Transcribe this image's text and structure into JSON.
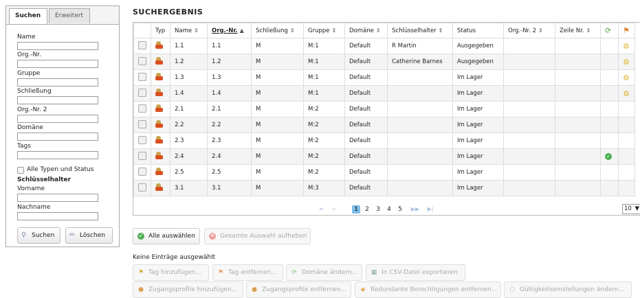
{
  "panel": {
    "tabs": [
      "Suchen",
      "Erweitert"
    ],
    "fields": [
      "Name",
      "Org.-Nr.",
      "Gruppe",
      "Schließung",
      "Org.-Nr. 2",
      "Domäne",
      "Tags"
    ],
    "all_types_label": "Alle Typen und Status",
    "keyholder_heading": "Schlüsselhalter",
    "firstname_label": "Vorname",
    "lastname_label": "Nachname",
    "search_button": "Suchen",
    "clear_button": "Löschen",
    "icons": {
      "search": "magnifier-icon",
      "clear": "eraser-icon"
    }
  },
  "results": {
    "title": "Suchergebnis",
    "columns": [
      "",
      "Typ",
      "Name",
      "Org.-Nr.",
      "Schließung",
      "Gruppe",
      "Domäne",
      "Schlüsselhalter",
      "Status",
      "Org.-Nr. 2",
      "Zeile Nr.",
      "",
      ""
    ],
    "sort_arrows": [
      "",
      "",
      "⇕",
      "▲",
      "⇕",
      "⇕",
      "⇕",
      "⇕",
      "",
      "⇕",
      "⇕",
      "",
      ""
    ],
    "rows": [
      {
        "name": "1.1",
        "org": "1.1",
        "closing": "M",
        "group": "M:1",
        "domain": "Default",
        "holder": "R Martin",
        "status": "Ausgegeben",
        "org2": "",
        "line": "",
        "ok": false,
        "gear": true
      },
      {
        "name": "1.2",
        "org": "1.2",
        "closing": "M",
        "group": "M:1",
        "domain": "Default",
        "holder": "Catherine Barnes",
        "status": "Ausgegeben",
        "org2": "",
        "line": "",
        "ok": false,
        "gear": true
      },
      {
        "name": "1.3",
        "org": "1.3",
        "closing": "M",
        "group": "M:1",
        "domain": "Default",
        "holder": "",
        "status": "Im Lager",
        "org2": "",
        "line": "",
        "ok": false,
        "gear": true
      },
      {
        "name": "1.4",
        "org": "1.4",
        "closing": "M",
        "group": "M:1",
        "domain": "Default",
        "holder": "",
        "status": "Im Lager",
        "org2": "",
        "line": "",
        "ok": false,
        "gear": true
      },
      {
        "name": "2.1",
        "org": "2.1",
        "closing": "M",
        "group": "M:2",
        "domain": "Default",
        "holder": "",
        "status": "Im Lager",
        "org2": "",
        "line": "",
        "ok": false,
        "gear": false
      },
      {
        "name": "2.2",
        "org": "2.2",
        "closing": "M",
        "group": "M:2",
        "domain": "Default",
        "holder": "",
        "status": "Im Lager",
        "org2": "",
        "line": "",
        "ok": false,
        "gear": false
      },
      {
        "name": "2.3",
        "org": "2.3",
        "closing": "M",
        "group": "M:2",
        "domain": "Default",
        "holder": "",
        "status": "Im Lager",
        "org2": "",
        "line": "",
        "ok": false,
        "gear": false
      },
      {
        "name": "2.4",
        "org": "2.4",
        "closing": "M",
        "group": "M:2",
        "domain": "Default",
        "holder": "",
        "status": "Im Lager",
        "org2": "",
        "line": "",
        "ok": true,
        "gear": false
      },
      {
        "name": "2.5",
        "org": "2.5",
        "closing": "M",
        "group": "M:2",
        "domain": "Default",
        "holder": "",
        "status": "Im Lager",
        "org2": "",
        "line": "",
        "ok": false,
        "gear": false
      },
      {
        "name": "3.1",
        "org": "3.1",
        "closing": "M",
        "group": "M:3",
        "domain": "Default",
        "holder": "",
        "status": "Im Lager",
        "org2": "",
        "line": "",
        "ok": false,
        "gear": false
      }
    ],
    "pager": {
      "first": "⇤",
      "prev": "⇦",
      "pages": [
        "1",
        "2",
        "3",
        "4",
        "5"
      ],
      "current": "1",
      "next": "▶▶",
      "last": "▶|",
      "page_size": "10"
    }
  },
  "actions": {
    "select_all": "Alle auswählen",
    "clear_selection": "Gesamte Auswahl aufheben",
    "none_selected": "Keine Einträge ausgewählt",
    "row1": [
      "Tag hinzufügen...",
      "Tag entfernen...",
      "Domäne ändern...",
      "In CSV-Datei exportieren"
    ],
    "row2": [
      "Zugangsprofile hinzufügen...",
      "Zugangsprofile entfernen...",
      "Redundante Berechtigungen entfernen...",
      "Gültigkeitseinstellungen ändern..."
    ]
  }
}
